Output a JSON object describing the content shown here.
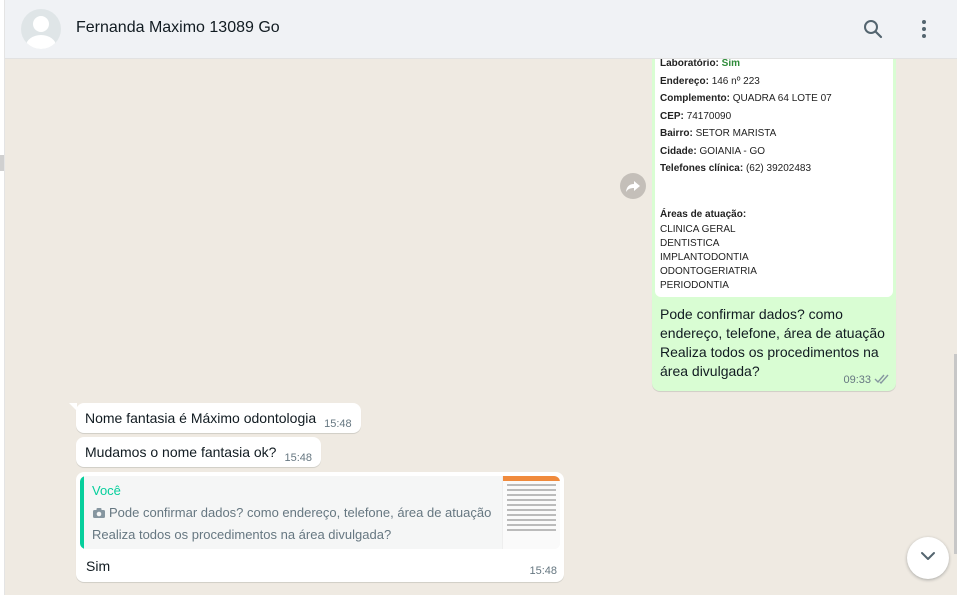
{
  "header": {
    "contact_name": "Fernanda Maximo 13089 Go"
  },
  "icons": {
    "search": "search-icon",
    "menu": "kebab-menu-icon",
    "forward": "forward-icon",
    "scroll_down": "chevron-down-icon",
    "camera": "camera-icon",
    "read_receipt": "double-check-icon"
  },
  "colors": {
    "header_bg": "#f0f2f5",
    "chat_bg": "#efeae2",
    "outgoing_bubble": "#d9fdd3",
    "incoming_bubble": "#ffffff",
    "accent_green": "#06cf9c"
  },
  "document": {
    "lab_label": "Laboratório:",
    "lab_value": "Sim",
    "endereco_label": "Endereço:",
    "endereco_value": "146 nº 223",
    "complemento_label": "Complemento:",
    "complemento_value": "QUADRA 64 LOTE 07",
    "cep_label": "CEP:",
    "cep_value": "74170090",
    "bairro_label": "Bairro:",
    "bairro_value": "SETOR MARISTA",
    "cidade_label": "Cidade:",
    "cidade_value": "GOIANIA - GO",
    "telefones_label": "Telefones clínica:",
    "telefones_value": "(62) 39202483",
    "areas_label": "Áreas de atuação:",
    "areas": [
      "CLINICA GERAL",
      "DENTISTICA",
      "IMPLANTODONTIA",
      "ODONTOGERIATRIA",
      "PERIODONTIA"
    ]
  },
  "outgoing_message": {
    "text": "Pode confirmar dados? como endereço, telefone, área de atuação Realiza todos os procedimentos na área divulgada?",
    "time": "09:33"
  },
  "incoming_messages": [
    {
      "text": "Nome fantasia é Máximo odontologia",
      "time": "15:48"
    },
    {
      "text": "Mudamos o nome fantasia ok?",
      "time": "15:48"
    }
  ],
  "reply_message": {
    "quote_author": "Você",
    "quote_text": "Pode confirmar dados? como endereço, telefone, área de atuação Realiza todos os procedimentos na área divulgada?",
    "text": "Sim",
    "time": "15:48"
  }
}
